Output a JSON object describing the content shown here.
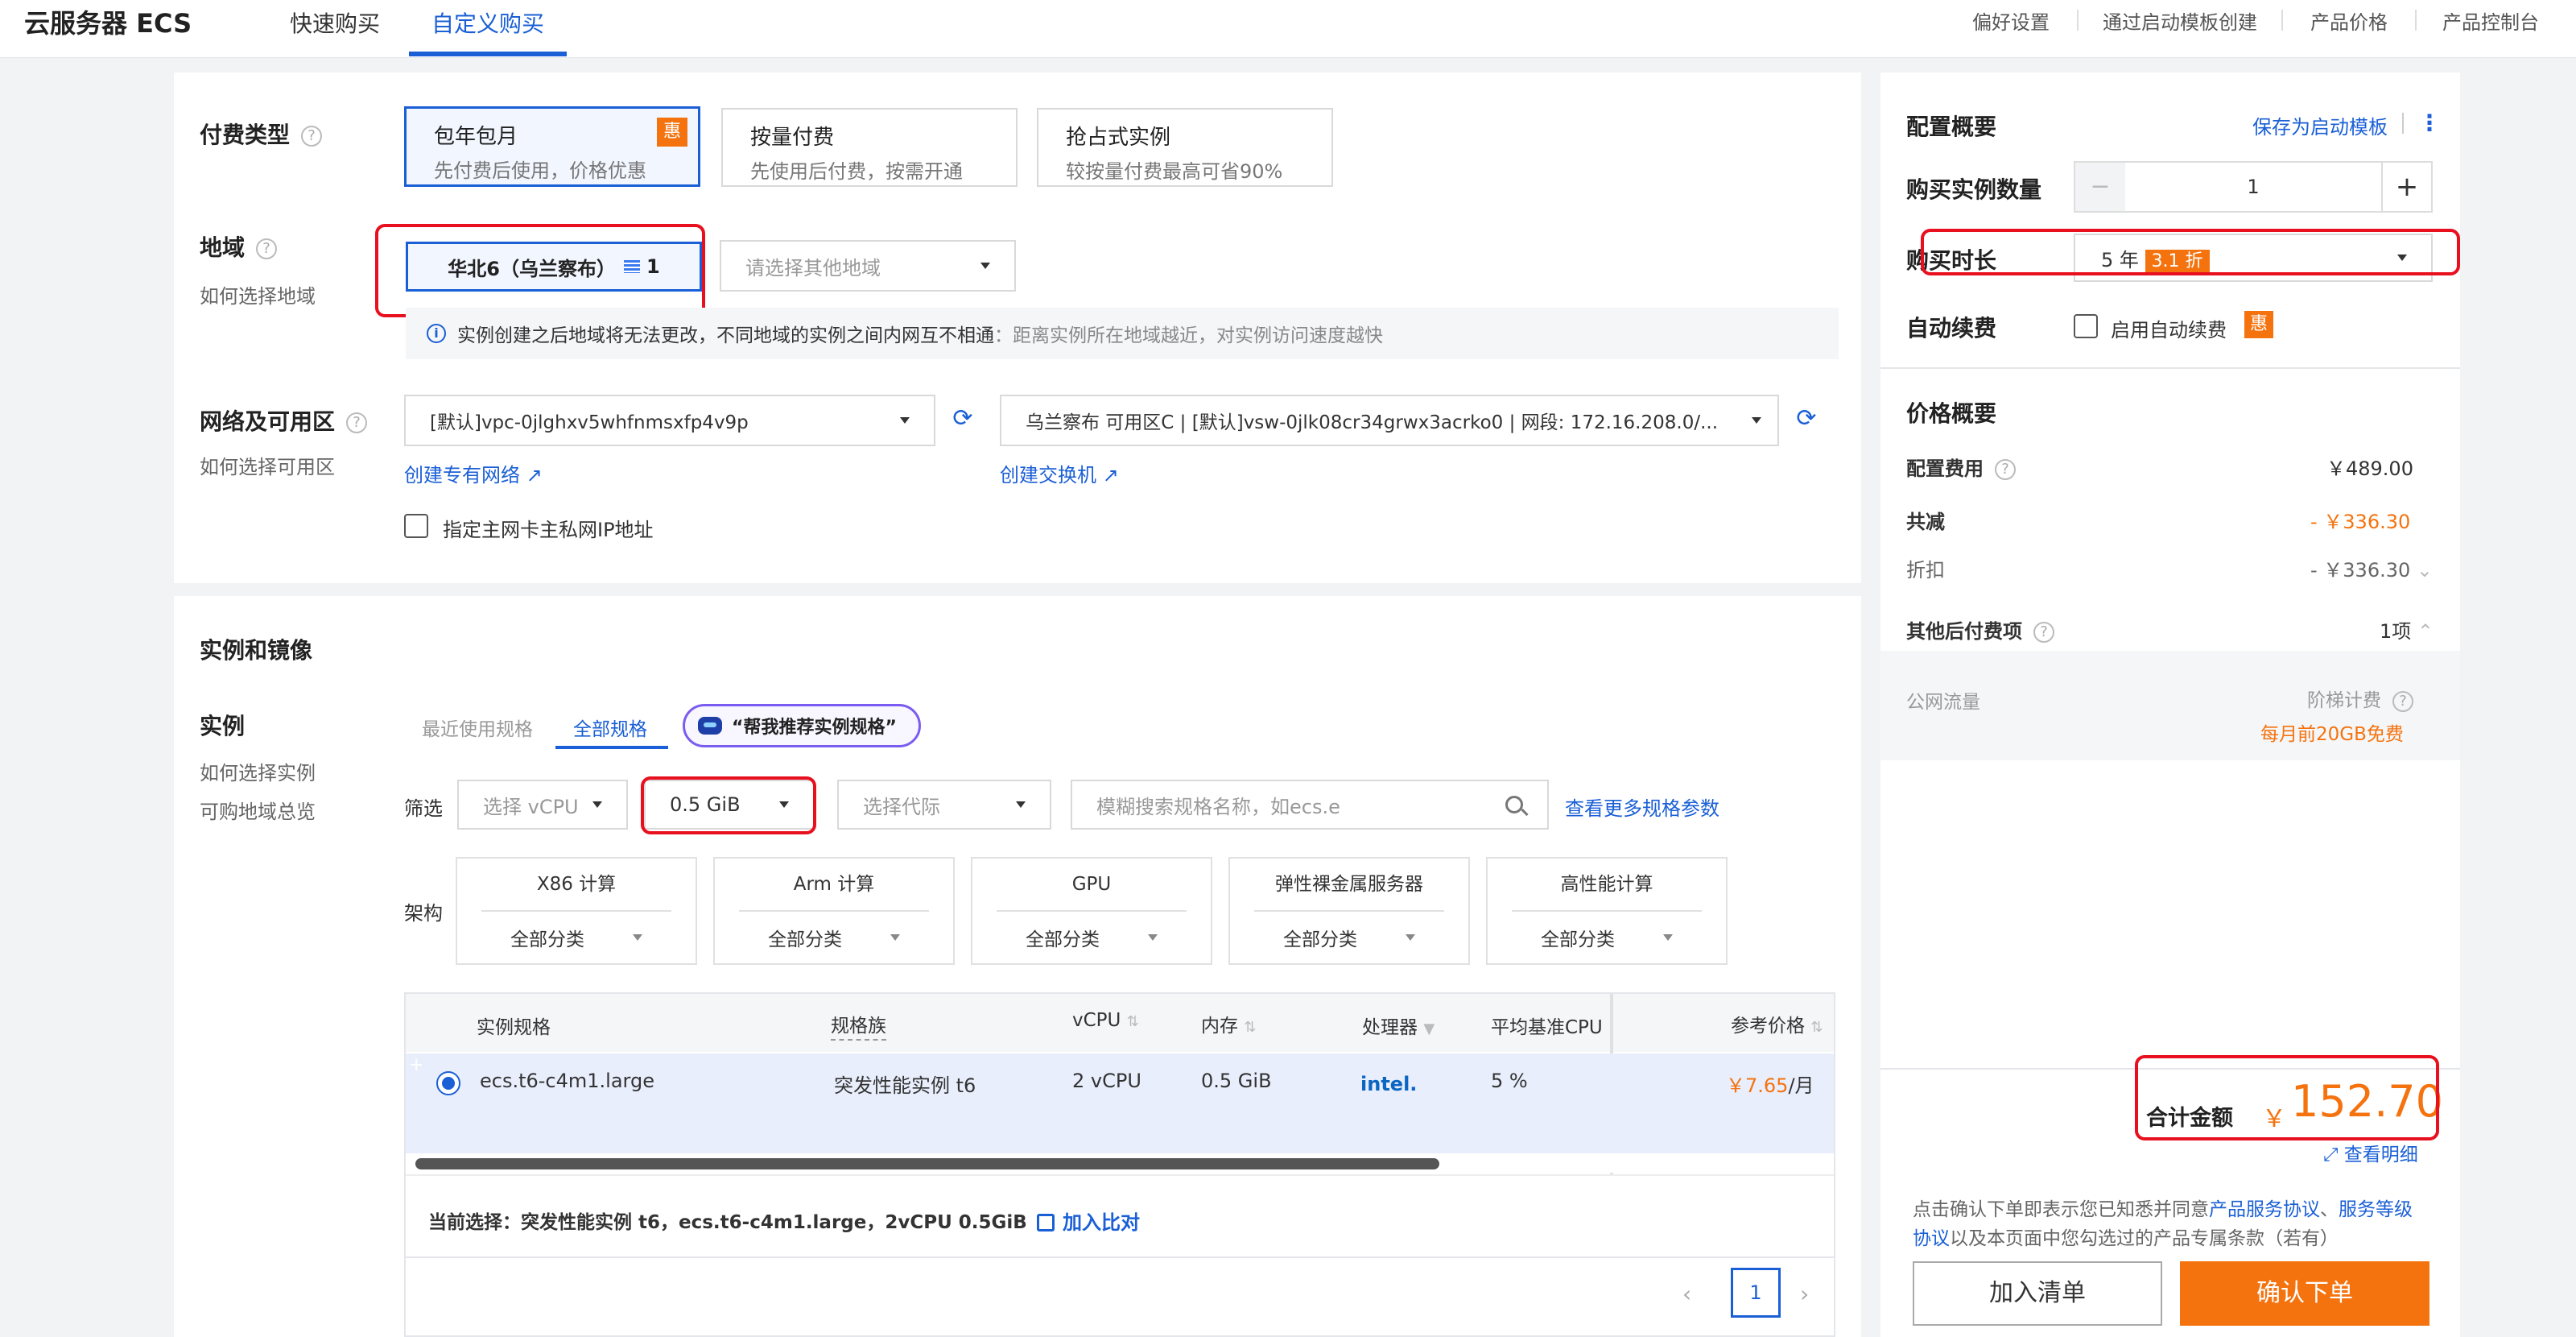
{
  "header": {
    "brand": "云服务器 ECS",
    "tabs": [
      {
        "label": "快速购买"
      },
      {
        "label": "自定义购买"
      }
    ],
    "links": [
      "偏好设置",
      "通过启动模板创建",
      "产品价格",
      "产品控制台"
    ]
  },
  "billing": {
    "label": "付费类型",
    "options": [
      {
        "title": "包年包月",
        "desc": "先付费后使用，价格优惠",
        "badge": "惠"
      },
      {
        "title": "按量付费",
        "desc": "先使用后付费，按需开通"
      },
      {
        "title": "抢占式实例",
        "desc": "较按量付费最高可省90%"
      }
    ]
  },
  "region": {
    "label": "地域",
    "help_link": "如何选择地域",
    "selected": "华北6（乌兰察布）",
    "zone_count": "1",
    "other_placeholder": "请选择其他地域",
    "notice_strong": "实例创建之后地域将无法更改，不同地域的实例之间内网互不相通",
    "notice_rest": "：距离实例所在地域越近，对实例访问速度越快"
  },
  "network": {
    "label": "网络及可用区",
    "help_link": "如何选择可用区",
    "vpc": "[默认]vpc-0jlghxv5whfnmsxfp4v9p",
    "vswitch": "乌兰察布 可用区C | [默认]vsw-0jlk08cr34grwx3acrko0 | 网段: 172.16.208.0/...",
    "create_vpc": "创建专有网络",
    "create_vsw": "创建交换机",
    "private_ip_checkbox": "指定主网卡主私网IP地址"
  },
  "instance": {
    "section_title": "实例和镜像",
    "label": "实例",
    "help_links": [
      "如何选择实例",
      "可购地域总览"
    ],
    "tabs": [
      "最近使用规格",
      "全部规格"
    ],
    "ai_button": "“帮我推荐实例规格”",
    "filter_label": "筛选",
    "vcpu_placeholder": "选择 vCPU",
    "memory_value": "0.5 GiB",
    "gen_placeholder": "选择代际",
    "search_placeholder": "模糊搜索规格名称，如ecs.e",
    "more_params": "查看更多规格参数",
    "arch_label": "架构",
    "arch": [
      {
        "name": "X86 计算",
        "cat": "全部分类"
      },
      {
        "name": "Arm 计算",
        "cat": "全部分类"
      },
      {
        "name": "GPU",
        "cat": "全部分类"
      },
      {
        "name": "弹性裸金属服务器",
        "cat": "全部分类"
      },
      {
        "name": "高性能计算",
        "cat": "全部分类"
      }
    ],
    "table": {
      "headers": [
        "实例规格",
        "规格族",
        "vCPU",
        "内存",
        "处理器",
        "平均基准CPU",
        "参考价格"
      ],
      "row": {
        "spec": "ecs.t6-c4m1.large",
        "family": "突发性能实例 t6",
        "vcpu": "2 vCPU",
        "mem": "0.5 GiB",
        "cpu": "intel.",
        "base": "5 %",
        "price": "￥7.65",
        "unit": "/月"
      }
    },
    "current_selection": "当前选择：突发性能实例 t6，ecs.t6-c4m1.large，2vCPU 0.5GiB",
    "add_compare": "加入比对",
    "page_number": "1"
  },
  "summary": {
    "title": "配置概要",
    "save_template": "保存为启动模板",
    "qty_label": "购买实例数量",
    "qty": "1",
    "duration_label": "购买时长",
    "duration": "5 年",
    "discount": "3.1 折",
    "autorenew_label": "自动续费",
    "autorenew_checkbox": "启用自动续费",
    "autorenew_badge": "惠",
    "price_title": "价格概要",
    "config_fee_label": "配置费用",
    "config_fee": "￥489.00",
    "total_discount_label": "共减",
    "total_discount": "- ￥336.30",
    "discount_label": "折扣",
    "discount_value": "- ￥336.30",
    "other_fee_label": "其他后付费项",
    "other_fee": "1项",
    "traffic_label": "公网流量",
    "traffic_billing": "阶梯计费",
    "traffic_free": "每月前20GB免费",
    "total_label": "合计金额",
    "total_currency": "￥",
    "total_value": "152.70",
    "details_link": "查看明细",
    "agreement_1": "点击确认下单即表示您已知悉并同意",
    "agreement_link1": "产品服务协议",
    "agreement_link2": "服务等级协议",
    "agreement_2": "以及本页面中您勾选过的产品专属条款（若有）",
    "cart_button": "加入清单",
    "order_button": "确认下单"
  }
}
